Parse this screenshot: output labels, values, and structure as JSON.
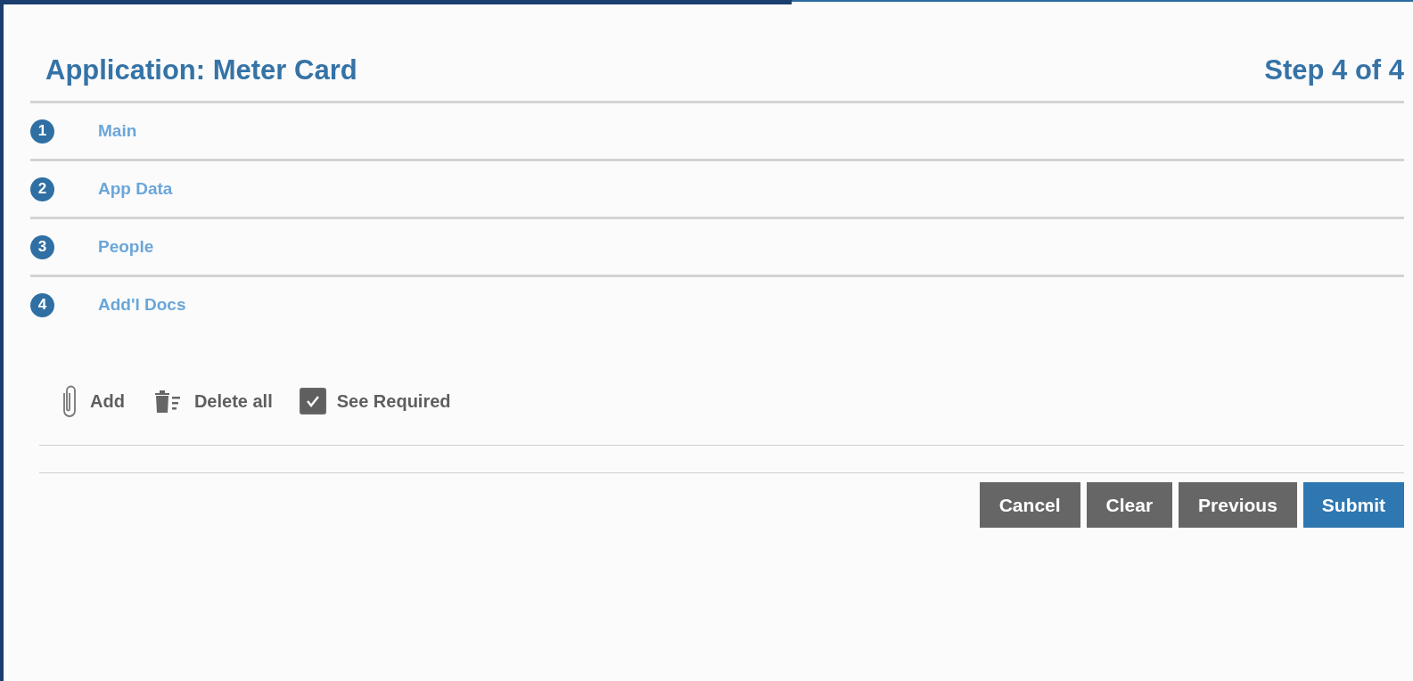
{
  "header": {
    "title": "Application: Meter Card",
    "step_indicator": "Step 4 of 4"
  },
  "steps": [
    {
      "number": "1",
      "label": "Main"
    },
    {
      "number": "2",
      "label": "App Data"
    },
    {
      "number": "3",
      "label": "People"
    },
    {
      "number": "4",
      "label": "Add'l Docs"
    }
  ],
  "toolbar": {
    "add": "Add",
    "delete_all": "Delete all",
    "see_required": {
      "label": "See Required",
      "checked": true
    }
  },
  "buttons": [
    {
      "label": "Cancel",
      "kind": "secondary"
    },
    {
      "label": "Clear",
      "kind": "secondary"
    },
    {
      "label": "Previous",
      "kind": "secondary"
    },
    {
      "label": "Submit",
      "kind": "primary"
    }
  ]
}
